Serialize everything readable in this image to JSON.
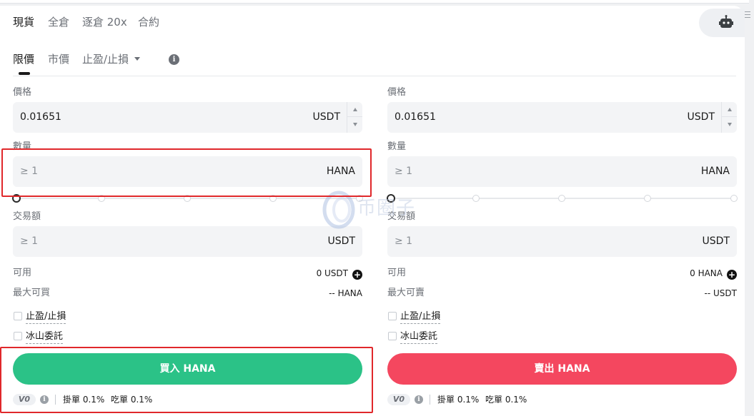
{
  "market_tabs": [
    "現貨",
    "全倉",
    "逐倉 20x",
    "合約"
  ],
  "order_tabs": {
    "limit": "限價",
    "market": "市價",
    "tpsl": "止盈/止損"
  },
  "info_icon_glyph": "i",
  "buy": {
    "price_label": "價格",
    "price_value": "0.01651",
    "price_unit": "USDT",
    "qty_label": "數量",
    "qty_placeholder": "≥ 1",
    "qty_unit": "HANA",
    "total_label": "交易額",
    "total_placeholder": "≥ 1",
    "total_unit": "USDT",
    "avail_label": "可用",
    "avail_value": "0 USDT",
    "max_label": "最大可買",
    "max_value": "-- HANA",
    "opt1": "止盈/止損",
    "opt2": "冰山委託",
    "button": "買入 HANA",
    "tier": "V0",
    "maker": "掛單 0.1%",
    "taker": "吃單 0.1%"
  },
  "sell": {
    "price_label": "價格",
    "price_value": "0.01651",
    "price_unit": "USDT",
    "qty_label": "數量",
    "qty_placeholder": "≥ 1",
    "qty_unit": "HANA",
    "total_label": "交易額",
    "total_placeholder": "≥ 1",
    "total_unit": "USDT",
    "avail_label": "可用",
    "avail_value": "0 HANA",
    "max_label": "最大可賣",
    "max_value": "-- USDT",
    "opt1": "止盈/止損",
    "opt2": "冰山委託",
    "button": "賣出 HANA",
    "tier": "V0",
    "maker": "掛單 0.1%",
    "taker": "吃單 0.1%"
  },
  "watermark": "币圈子",
  "colors": {
    "buy": "#2bc287",
    "sell": "#f4475f",
    "highlight": "#e0282b"
  },
  "icons": [
    "robot-icon",
    "menu-grip-icon",
    "info-icon",
    "chevron-down-icon",
    "plus-circle-icon"
  ]
}
